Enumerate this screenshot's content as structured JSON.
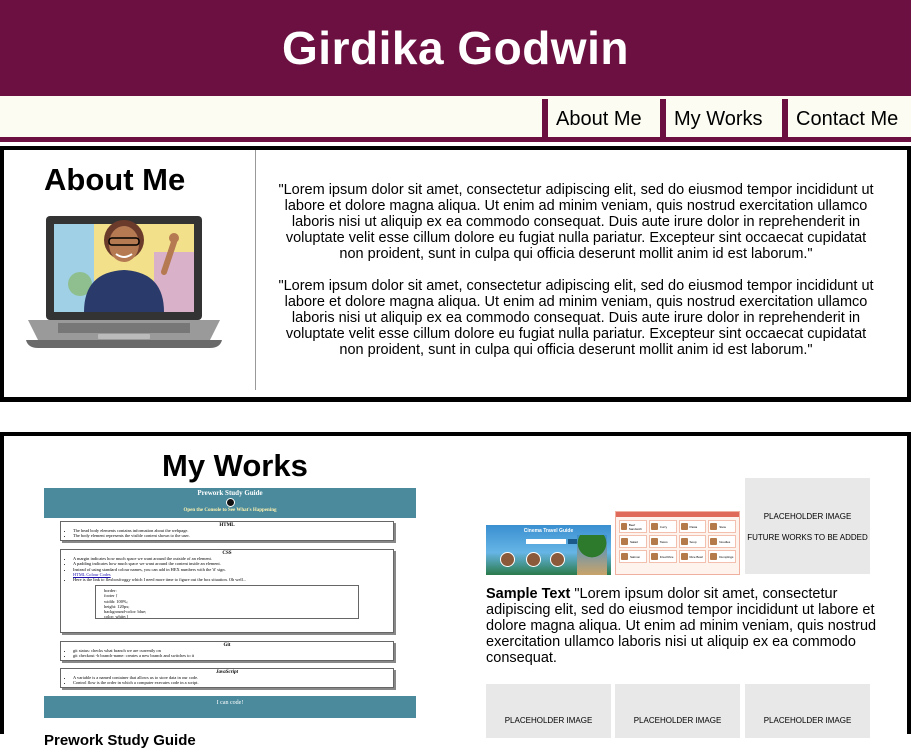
{
  "header": {
    "title": "Girdika Godwin"
  },
  "nav": {
    "about": "About Me",
    "works": "My Works",
    "contact": "Contact Me"
  },
  "about": {
    "heading": "About Me",
    "paragraph1": "\"Lorem ipsum dolor sit amet, consectetur adipiscing elit, sed do eiusmod tempor incididunt ut labore et dolore magna aliqua. Ut enim ad minim veniam, quis nostrud exercitation ullamco laboris nisi ut aliquip ex ea commodo consequat. Duis aute irure dolor in reprehenderit in voluptate velit esse cillum dolore eu fugiat nulla pariatur. Excepteur sint occaecat cupidatat non proident, sunt in culpa qui officia deserunt mollit anim id est laborum.\"",
    "paragraph2": "\"Lorem ipsum dolor sit amet, consectetur adipiscing elit, sed do eiusmod tempor incididunt ut labore et dolore magna aliqua. Ut enim ad minim veniam, quis nostrud exercitation ullamco laboris nisi ut aliquip ex ea commodo consequat. Duis aute irure dolor in reprehenderit in voluptate velit esse cillum dolore eu fugiat nulla pariatur. Excepteur sint occaecat cupidatat non proident, sunt in culpa qui officia deserunt mollit anim id est laborum.\""
  },
  "works": {
    "heading": "My Works",
    "study_guide": {
      "title": "Prework Study Guide",
      "subtitle": "Open the Console to See What's Happening",
      "html_heading": "HTML",
      "html_items": [
        "The head body elements contains information about the webpage.",
        "The body element represents the visible content shown to the user."
      ],
      "css_heading": "CSS",
      "css_items": [
        "A margin indicates how much space we want around the outside of an element.",
        "A padding indicates how much space we want around the content inside an element.",
        "Instead of using standard colour names, you can add in HEX numbers with the '#' sign.",
        "HTML Colour Codes",
        "Here is the link to flexboxfroggy which I need more time to figure out the box situation. Oh well..."
      ],
      "css_code": [
        "border:",
        "footer {",
        "width: 100%;",
        "height: 120px;",
        "background-color: blue;",
        "color: white;}"
      ],
      "git_heading": "Git",
      "git_items": [
        "git status: checks what branch we are currently on",
        "git checkout -b branch-name: creates a new branch and switches to it"
      ],
      "js_heading": "JavaScript",
      "js_items": [
        "A variable is a named container that allows us to store data in our code.",
        "Control flow is the order in which a computer executes code in a script."
      ],
      "footer": "I can code!"
    },
    "bottom_text": "Prework Study Guide",
    "travel_title": "Cinema Travel Guide",
    "sample_label": "Sample Text",
    "sample_text": " \"Lorem ipsum dolor sit amet, consectetur adipiscing elit, sed do eiusmod tempor incididunt ut labore et dolore magna aliqua. Ut enim ad minim veniam, quis nostrud exercitation ullamco laboris nisi ut aliquip ex ea commodo consequat.",
    "placeholder_label": "PLACEHOLDER IMAGE",
    "placeholder_note": "FUTURE WORKS TO BE ADDED",
    "food_items": [
      "Beef Sandwich",
      "Curry",
      "Pasta",
      "Stew",
      "Salad",
      "Tacos",
      "Soup",
      "Noodles",
      "Salmon",
      "Fried Rice",
      "Rice Bowl",
      "Dumplings"
    ]
  },
  "colors": {
    "brand": "#6b1040",
    "nav_bg": "#fcfcf3",
    "study_bar": "#4a8a9c"
  }
}
